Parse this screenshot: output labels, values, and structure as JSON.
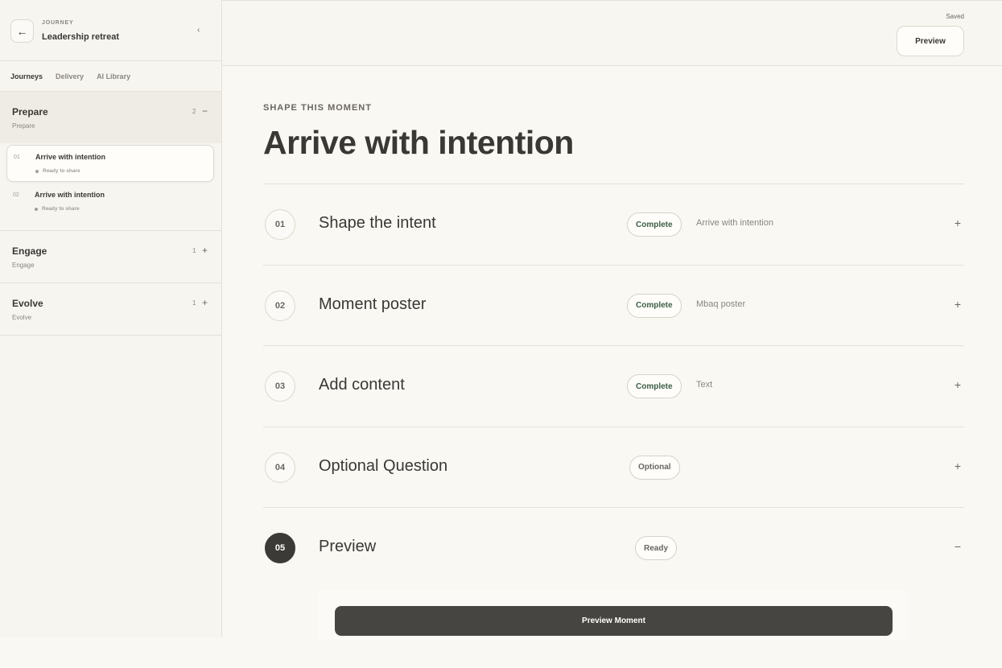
{
  "sidebar": {
    "eyebrow": "JOURNEY",
    "title": "Leadership retreat",
    "back_icon": "←",
    "collapse_icon": "‹",
    "tabs": [
      "Journeys",
      "Delivery",
      "AI Library"
    ],
    "sections": [
      {
        "title": "Prepare",
        "subtitle": "Prepare",
        "count": "2",
        "toggle": "−",
        "moments": [
          {
            "num": "01",
            "title": "Arrive with intention",
            "status": "Ready to share"
          },
          {
            "num": "02",
            "title": "Arrive with intention",
            "status": "Ready to share"
          }
        ]
      },
      {
        "title": "Engage",
        "subtitle": "Engage",
        "count": "1",
        "toggle": "+"
      },
      {
        "title": "Evolve",
        "subtitle": "Evolve",
        "count": "1",
        "toggle": "+"
      }
    ]
  },
  "topbar": {
    "saved": "Saved",
    "preview_label": "Preview"
  },
  "main": {
    "eyebrow": "SHAPE THIS MOMENT",
    "heading": "Arrive with intention",
    "steps": [
      {
        "num": "01",
        "title": "Shape the intent",
        "badge": "Complete",
        "value": "Arrive with intention",
        "toggle": "+"
      },
      {
        "num": "02",
        "title": "Moment poster",
        "badge": "Complete",
        "value": "Mbaq poster",
        "toggle": "+"
      },
      {
        "num": "03",
        "title": "Add content",
        "badge": "Complete",
        "value": "Text",
        "toggle": "+"
      },
      {
        "num": "04",
        "title": "Optional Question",
        "badge": "Optional",
        "value": "",
        "toggle": "+"
      },
      {
        "num": "05",
        "title": "Preview",
        "badge": "Ready",
        "value": "",
        "toggle": "−"
      }
    ],
    "cta_label": "Preview Moment"
  },
  "colors": {
    "background": "#faf8f3",
    "accent_dark": "#3c3a37",
    "complete_text": "#3d5e45"
  }
}
